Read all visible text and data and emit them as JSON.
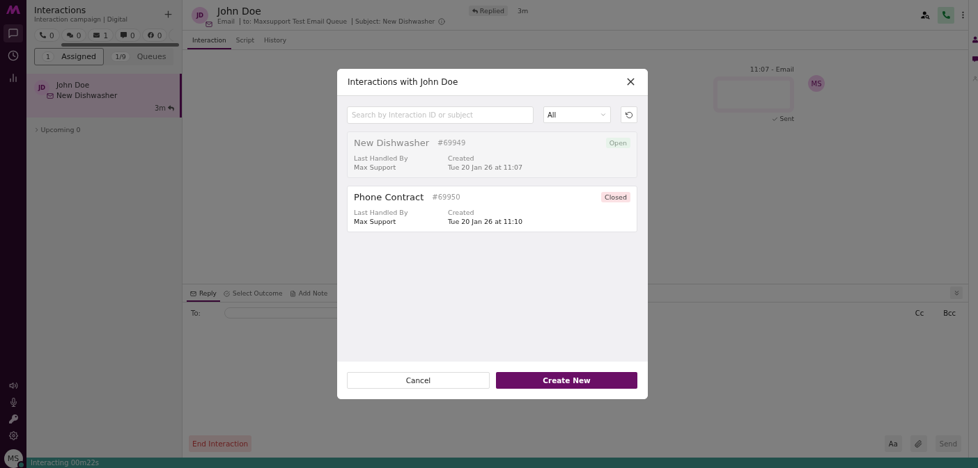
{
  "nav": {
    "items": [
      {
        "kind": "chat",
        "selected": true
      },
      {
        "kind": "history",
        "selected": false
      },
      {
        "kind": "stats",
        "selected": false
      }
    ],
    "tools": [
      {
        "kind": "speaker"
      },
      {
        "kind": "mic"
      },
      {
        "kind": "key"
      },
      {
        "kind": "settings"
      }
    ],
    "user": {
      "initials": "MS",
      "online": true
    }
  },
  "sidebar": {
    "title": "Interactions",
    "subtitle": "Interaction campaign | Digital",
    "channels": [
      {
        "kind": "phone",
        "count": "0"
      },
      {
        "kind": "chat",
        "count": "0"
      },
      {
        "kind": "email",
        "count": "1"
      },
      {
        "kind": "sms",
        "count": "0"
      },
      {
        "kind": "facebook",
        "count": "0"
      }
    ],
    "segments": [
      {
        "count": "1",
        "label": "Assigned",
        "selected": true
      },
      {
        "count": "1/9",
        "label": "Queues",
        "selected": false
      }
    ],
    "items": [
      {
        "initials": "JD",
        "name": "John Doe",
        "subject": "New Dishwasher",
        "time": "3m",
        "selected": true
      }
    ],
    "upcoming": {
      "label": "Upcoming 0",
      "expanded": false
    }
  },
  "header": {
    "initials": "JD",
    "name": "John Doe",
    "channel": "Email",
    "to": "to: Maxsupport Test Email Queue",
    "subject": "Subject: New Dishwasher",
    "status": "Replied",
    "time": "3m"
  },
  "tabs": [
    {
      "label": "Interaction",
      "selected": true
    },
    {
      "label": "Script",
      "selected": false
    },
    {
      "label": "History",
      "selected": false
    }
  ],
  "messages": [
    {
      "meta": "11:07 - Email",
      "initials": "MS",
      "status": "Sent"
    }
  ],
  "composer": {
    "tabs": [
      {
        "kind": "reply",
        "label": "Reply",
        "selected": true
      },
      {
        "kind": "outcome",
        "label": "Select Outcome",
        "selected": false
      },
      {
        "kind": "note",
        "label": "Add Note",
        "selected": false
      }
    ],
    "to_label": "To:",
    "cc": "Cc",
    "bcc": "Bcc",
    "end_button": "End Interaction",
    "format_button": "Aa",
    "send_button": "Send",
    "send_disabled": true
  },
  "status_bar": "Interacting 00m22s",
  "dialog": {
    "title": "Interactions with John Doe",
    "search_placeholder": "Search by Interaction ID or subject",
    "filter": "All",
    "items": [
      {
        "subject": "New Dishwasher",
        "id": "#69949",
        "status": "Open",
        "color": "#e7f3ea",
        "disabled": true,
        "handled_label": "Last Handled By",
        "handled_by": "Max Support",
        "created_label": "Created",
        "created": "Tue 20 Jan 26 at 11:07"
      },
      {
        "subject": "Phone Contract",
        "id": "#69950",
        "status": "Closed",
        "color": "#fbe1e4",
        "disabled": false,
        "handled_label": "Last Handled By",
        "handled_by": "Max Support",
        "created_label": "Created",
        "created": "Tue 20 Jan 26 at 11:10"
      }
    ],
    "cancel": "Cancel",
    "create": "Create New"
  }
}
